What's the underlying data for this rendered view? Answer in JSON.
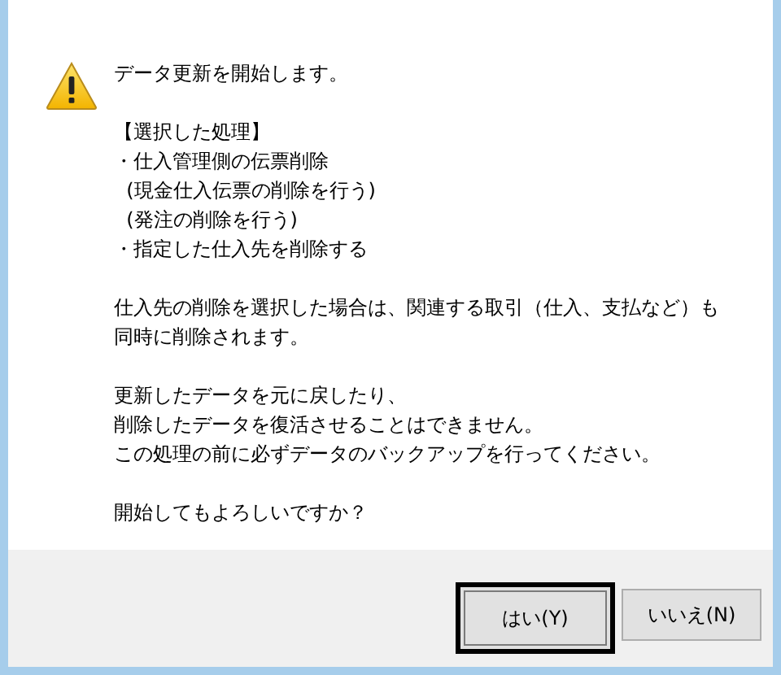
{
  "icon": {
    "kind": "warning"
  },
  "paragraphs": [
    {
      "lines": [
        "データ更新を開始します。"
      ]
    },
    {
      "lines": [
        "【選択した処理】",
        "・仕入管理側の伝票削除",
        "  (現金仕入伝票の削除を行う)",
        "  (発注の削除を行う)",
        "・指定した仕入先を削除する"
      ]
    },
    {
      "lines": [
        "仕入先の削除を選択した場合は、関連する取引（仕入、支払など）も",
        "同時に削除されます。"
      ]
    },
    {
      "lines": [
        "更新したデータを元に戻したり、",
        "削除したデータを復活させることはできません。",
        "この処理の前に必ずデータのバックアップを行ってください。"
      ]
    },
    {
      "lines": [
        "開始してもよろしいですか？"
      ]
    }
  ],
  "buttons": [
    {
      "label": "はい(Y)",
      "default": true
    },
    {
      "label": "いいえ(N)",
      "default": false
    }
  ]
}
